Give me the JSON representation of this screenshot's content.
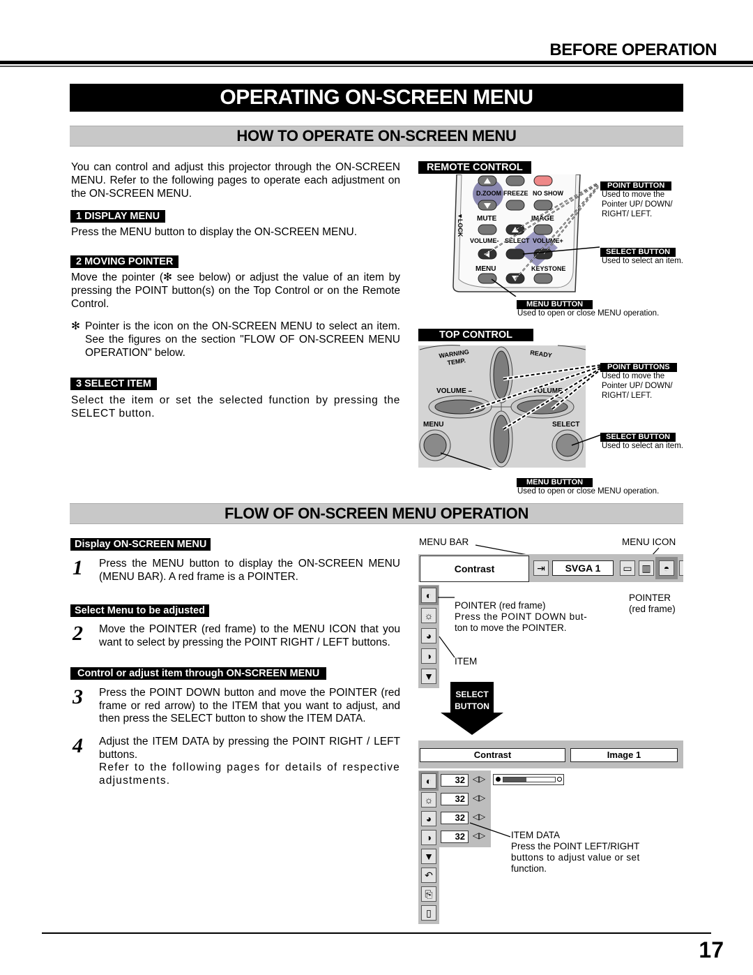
{
  "header": {
    "section_title": "BEFORE OPERATION"
  },
  "page_title": "OPERATING ON-SCREEN MENU",
  "how_to": {
    "heading": "HOW TO OPERATE ON-SCREEN MENU",
    "intro": "You can control and adjust this projector through the ON-SCREEN MENU.  Refer to the following pages to operate each adjustment on the ON-SCREEN MENU.",
    "steps": [
      {
        "tag": "1  DISPLAY MENU",
        "text": "Press the MENU button to display the ON-SCREEN MENU."
      },
      {
        "tag": "2  MOVING POINTER",
        "text": "Move the pointer (✻ see below) or adjust the value of an item by pressing the POINT button(s) on the Top Control or on the Remote Control."
      },
      {
        "tag": "3  SELECT ITEM",
        "text": "Select the item or set the selected function by pressing the SELECT button."
      }
    ],
    "pointer_note": {
      "mark": "✻",
      "text": "Pointer is the icon on the ON-SCREEN MENU to select an item. See the figures on the section \"FLOW OF ON-SCREEN MENU OPERATION\" below."
    }
  },
  "remote_control": {
    "tag": "REMOTE CONTROL",
    "buttons": {
      "dzoom": "D.ZOOM",
      "freeze": "FREEZE",
      "noshow": "NO SHOW",
      "mute": "MUTE",
      "image": "IMAGE",
      "volume_minus": "VOLUME-",
      "select": "SELECT",
      "volume_plus": "VOLUME+",
      "menu": "MENU",
      "keystone": "KEYSTONE",
      "lock": "▼LOCK"
    },
    "callouts": [
      {
        "tag": "POINT BUTTON",
        "text": [
          "Used to move the",
          "Pointer UP/ DOWN/",
          "RIGHT/ LEFT."
        ]
      },
      {
        "tag": "SELECT BUTTON",
        "text": [
          "Used to select an item."
        ]
      },
      {
        "tag": "MENU BUTTON",
        "text": [
          "Used to open or close MENU operation."
        ]
      }
    ]
  },
  "top_control": {
    "tag": "TOP CONTROL",
    "labels": {
      "warning": "WARNING",
      "temp": "TEMP.",
      "ready": "READY",
      "volume_minus": "VOLUME –",
      "volume_plus": "VOLUME +",
      "menu": "MENU",
      "select": "SELECT"
    },
    "callouts": [
      {
        "tag": "POINT BUTTONS",
        "text": [
          "Used to move the",
          "Pointer UP/ DOWN/",
          "RIGHT/ LEFT."
        ]
      },
      {
        "tag": "SELECT BUTTON",
        "text": [
          "Used to select an item."
        ]
      },
      {
        "tag": "MENU BUTTON",
        "text": [
          "Used to open or close MENU operation."
        ]
      }
    ]
  },
  "flow": {
    "heading": "FLOW OF ON-SCREEN MENU OPERATION",
    "groups": [
      {
        "tag": "Display ON-SCREEN MENU",
        "steps": [
          {
            "num": "1",
            "text": "Press the MENU button to display the ON-SCREEN MENU (MENU BAR).  A red frame is a POINTER."
          }
        ]
      },
      {
        "tag": "Select Menu to be adjusted",
        "steps": [
          {
            "num": "2",
            "text": "Move the POINTER (red frame) to the MENU ICON that you want to select by pressing the POINT RIGHT / LEFT buttons."
          }
        ]
      },
      {
        "tag": "Control or adjust item through ON-SCREEN MENU",
        "steps": [
          {
            "num": "3",
            "text": "Press the POINT DOWN button and move the POINTER (red frame or red arrow) to the ITEM that you want to adjust, and then press the SELECT button to show the ITEM DATA."
          },
          {
            "num": "4",
            "text": "Adjust the ITEM DATA by pressing the POINT RIGHT / LEFT buttons.",
            "extra": "Refer to the following pages for details of respective adjustments."
          }
        ]
      }
    ],
    "diagram": {
      "menu_bar_label": "MENU BAR",
      "menu_icon_label": "MENU ICON",
      "contrast_label": "Contrast",
      "source_label": "SVGA 1",
      "pointer_top_label": [
        "POINTER",
        "(red frame)"
      ],
      "pointer_item_label": [
        "POINTER (red frame)",
        "Press the POINT DOWN but-",
        "ton to move the POINTER."
      ],
      "item_label": "ITEM",
      "select_arrow": [
        "SELECT",
        "BUTTON"
      ],
      "item_screen": {
        "contrast_label": "Contrast",
        "mode_label": "Image 1",
        "values": [
          "32",
          "32",
          "32",
          "32"
        ],
        "slider_fraction": 0.45
      },
      "item_data_label": [
        "ITEM DATA",
        "Press the POINT LEFT/RIGHT",
        "buttons to adjust value or set",
        "function."
      ],
      "icons": [
        "contrast-icon",
        "brightness-icon",
        "color-icon",
        "tint-icon",
        "more-down-icon",
        "reset-icon",
        "store-icon",
        "quit-icon"
      ],
      "menu_icons": [
        "input-icon",
        "pc-adjust-icon",
        "screen-icon",
        "image-icon"
      ]
    }
  },
  "footer": {
    "page_number": "17"
  }
}
